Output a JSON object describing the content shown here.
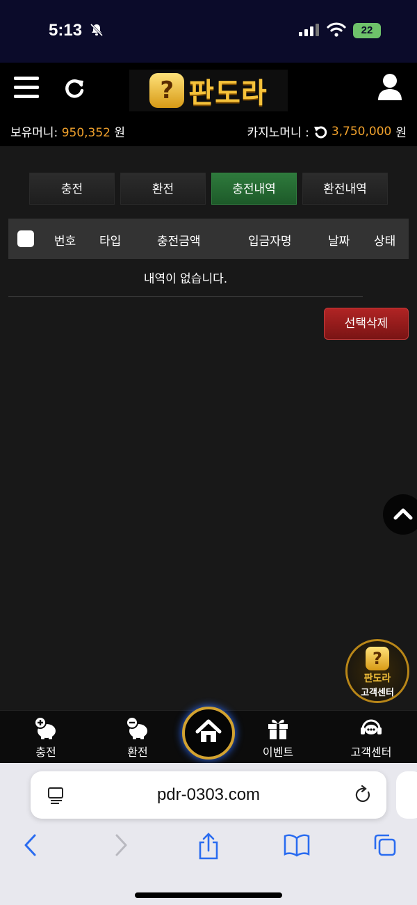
{
  "status_bar": {
    "time": "5:13",
    "battery": "22"
  },
  "header": {
    "logo_text": "판도라",
    "logo_badge": "?"
  },
  "money": {
    "holding_label": "보유머니:",
    "holding_value": "950,352",
    "holding_unit": "원",
    "casino_label": "카지노머니 :",
    "casino_value": "3,750,000",
    "casino_unit": "원"
  },
  "tabs": [
    {
      "label": "충전",
      "active": false
    },
    {
      "label": "환전",
      "active": false
    },
    {
      "label": "충전내역",
      "active": true
    },
    {
      "label": "환전내역",
      "active": false
    }
  ],
  "table": {
    "columns": [
      "번호",
      "타입",
      "충전금액",
      "입금자명",
      "날짜",
      "상태"
    ],
    "empty_message": "내역이 없습니다."
  },
  "actions": {
    "delete_selected": "선택삭제"
  },
  "cs_badge": {
    "brand": "판도라",
    "label": "고객센터",
    "badge": "?"
  },
  "bottom_nav": {
    "charge": "충전",
    "exchange": "환전",
    "event": "이벤트",
    "support": "고객센터"
  },
  "browser": {
    "url": "pdr-0303.com"
  },
  "colors": {
    "accent_gold": "#f0a12c",
    "active_tab": "#2e7a3c",
    "delete_red": "#b02424"
  }
}
